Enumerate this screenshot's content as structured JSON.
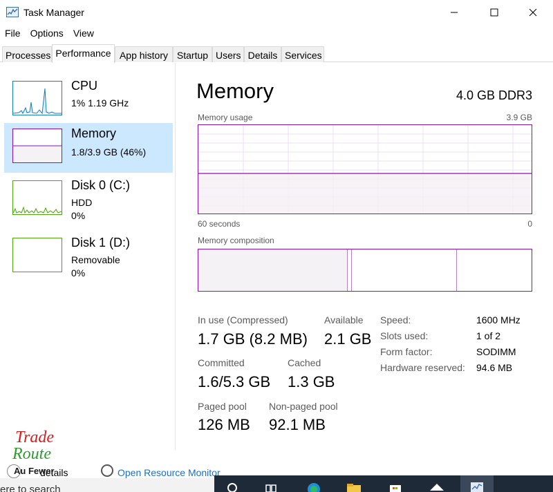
{
  "window": {
    "title": "Task Manager"
  },
  "menu": {
    "file": "File",
    "options": "Options",
    "view": "View"
  },
  "tabs": [
    "Processes",
    "Performance",
    "App history",
    "Startup",
    "Users",
    "Details",
    "Services"
  ],
  "sidebar": {
    "cpu": {
      "name": "CPU",
      "sub1": "1%  1.19 GHz"
    },
    "memory": {
      "name": "Memory",
      "sub1": "1.8/3.9 GB (46%)"
    },
    "disk0": {
      "name": "Disk 0 (C:)",
      "sub1": "HDD",
      "sub2": "0%"
    },
    "disk1": {
      "name": "Disk 1 (D:)",
      "sub1": "Removable",
      "sub2": "0%"
    }
  },
  "memory": {
    "title": "Memory",
    "spec": "4.0 GB DDR3",
    "usage_label": "Memory usage",
    "usage_max": "3.9 GB",
    "time_label": "60 seconds",
    "time_end": "0",
    "usage_fraction": 0.46,
    "composition_label": "Memory composition",
    "stats": {
      "in_use_label": "In use (Compressed)",
      "in_use_value": "1.7 GB (8.2 MB)",
      "available_label": "Available",
      "available_value": "2.1 GB",
      "committed_label": "Committed",
      "committed_value": "1.6/5.3 GB",
      "cached_label": "Cached",
      "cached_value": "1.3 GB",
      "paged_label": "Paged pool",
      "paged_value": "126 MB",
      "nonpaged_label": "Non-paged pool",
      "nonpaged_value": "92.1 MB"
    },
    "specs": {
      "speed_label": "Speed:",
      "speed_value": "1600 MHz",
      "slots_label": "Slots used:",
      "slots_value": "1 of 2",
      "form_label": "Form factor:",
      "form_value": "SODIMM",
      "hw_label": "Hardware reserved:",
      "hw_value": "94.6 MB"
    }
  },
  "footer": {
    "fewer_details": "details",
    "open_monitor": "Open Resource Monitor",
    "logo_line1": "Trade",
    "logo_line2": "Route",
    "logo_line3": "Au Fewer"
  },
  "taskbar": {
    "search_text": "ere to search"
  },
  "colors": {
    "memory_accent": "#8b12ae",
    "cpu_accent": "#117dbb",
    "disk_accent": "#4da60c",
    "selected_bg": "#cce8ff"
  }
}
